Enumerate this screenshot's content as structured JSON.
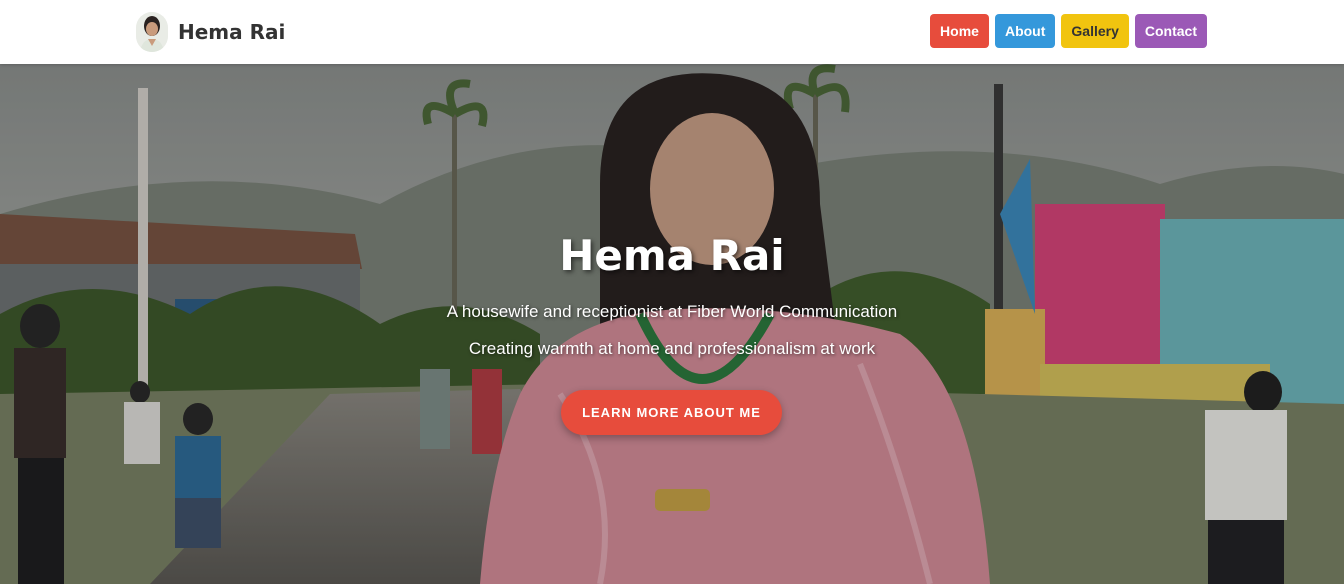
{
  "navbar": {
    "brand_name": "Hema Rai",
    "avatar_icon": "profile-photo",
    "links": [
      {
        "label": "Home",
        "color": "#e74c3c",
        "text_color": "#ffffff"
      },
      {
        "label": "About",
        "color": "#3498db",
        "text_color": "#ffffff"
      },
      {
        "label": "Gallery",
        "color": "#f1c40f",
        "text_color": "#333333"
      },
      {
        "label": "Contact",
        "color": "#9b59b6",
        "text_color": "#ffffff"
      }
    ]
  },
  "hero": {
    "title": "Hema Rai",
    "subtitle": "A housewife and receptionist at Fiber World Communication",
    "tagline": "Creating warmth at home and professionalism at work",
    "cta_label": "LEARN MORE ABOUT ME",
    "cta_color": "#e74c3c"
  }
}
